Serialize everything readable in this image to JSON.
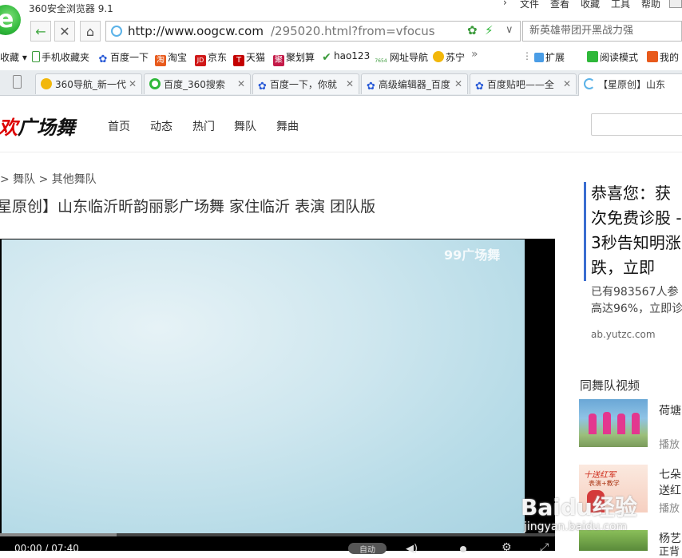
{
  "window": {
    "title": "360安全浏览器 9.1",
    "menu": [
      "文件",
      "查看",
      "收藏",
      "工具",
      "帮助"
    ]
  },
  "addressbar": {
    "url_host": "http://www.oogcw.com",
    "url_rest": "/295020.html?from=vfocus",
    "search_placeholder": "新英雄带团开黑战力强"
  },
  "bookmarks": {
    "items": [
      {
        "label": "收藏",
        "icon": "star-icon"
      },
      {
        "label": "手机收藏夹",
        "icon": "phone-icon"
      },
      {
        "label": "百度一下",
        "icon": "baidu-paw-icon"
      },
      {
        "label": "淘宝",
        "icon": "taobao-icon"
      },
      {
        "label": "京东",
        "icon": "jd-icon"
      },
      {
        "label": "天猫",
        "icon": "tmall-icon"
      },
      {
        "label": "聚划算",
        "icon": "juhuasuan-icon"
      },
      {
        "label": "hao123",
        "icon": "hao123-icon"
      },
      {
        "label": "网址导航",
        "icon": "7654-icon"
      },
      {
        "label": "苏宁",
        "icon": "suning-icon"
      },
      {
        "label": "扩展",
        "icon": "grid-icon"
      },
      {
        "label": "阅读模式",
        "icon": "book-icon"
      },
      {
        "label": "我的",
        "icon": "briefcase-icon"
      }
    ],
    "icon_texts": {
      "taobao": "淘",
      "jd": "JD",
      "tmall": "T",
      "juhuasuan": "聚",
      "7654": "7654"
    }
  },
  "tabs": [
    {
      "label": "360导航_新一代",
      "active": false
    },
    {
      "label": "百度_360搜索",
      "active": false
    },
    {
      "label": "百度一下，你就",
      "active": false
    },
    {
      "label": "高级编辑器_百度",
      "active": false
    },
    {
      "label": "百度贴吧——全",
      "active": false
    },
    {
      "label": "【星原创】山东",
      "active": true
    }
  ],
  "site": {
    "logo_red": "欢",
    "logo_black": "广场舞",
    "nav": [
      "首页",
      "动态",
      "热门",
      "舞队",
      "舞曲"
    ]
  },
  "breadcrumb": "> 舞队 > 其他舞队",
  "page_title": "星原创】山东临沂昕韵丽影广场舞 家住临沂 表演 团队版",
  "video": {
    "watermark": "99广场舞",
    "time": "00:00 / 07:40",
    "progress": 0.21,
    "control_label": "自动"
  },
  "ad": {
    "headline": "恭喜您：获次免费诊股 - 3秒告知明涨跌，立即",
    "desc_line1": "已有983567人参",
    "desc_line2": "高达96%，立即诊",
    "url": "ab.yutzc.com"
  },
  "related": {
    "title": "同舞队视频",
    "items": [
      {
        "title": "荷塘",
        "sub": "播放"
      },
      {
        "title": "七朵",
        "sub": "送红"
      },
      {
        "title": "杨艺",
        "sub": "正背"
      }
    ],
    "thumb2_text": "十送红军",
    "thumb2_sub": "表演+教学",
    "play2": "播放"
  },
  "overlay": {
    "baidu": "Baidu经验",
    "jingyan": "jingyan.baidu.com"
  },
  "colors": {
    "accent": "#2fb83a",
    "logo_red": "#d00000",
    "ad_bar": "#3a6dd0",
    "video_sky": "#b6dbe7"
  }
}
